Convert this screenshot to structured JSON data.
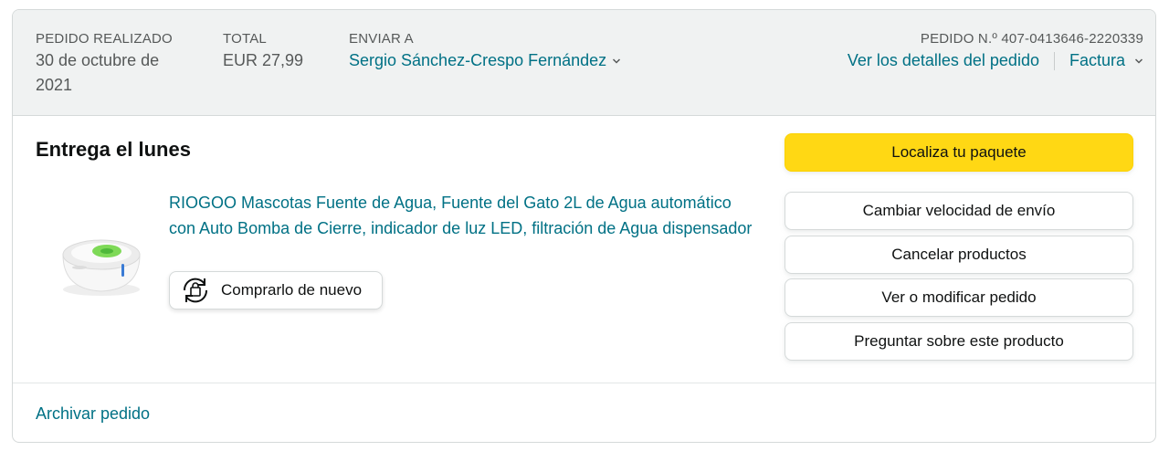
{
  "header": {
    "placed": {
      "label": "PEDIDO REALIZADO",
      "value_line1": "30 de octubre de",
      "value_line2": "2021"
    },
    "total": {
      "label": "TOTAL",
      "value": "EUR 27,99"
    },
    "ship_to": {
      "label": "ENVIAR A",
      "value": "Sergio Sánchez-Crespo Fernández"
    },
    "order_number": {
      "label": "PEDIDO N.º 407-0413646-2220339"
    },
    "details_link": "Ver los detalles del pedido",
    "invoice_link": "Factura"
  },
  "shipment": {
    "status_title": "Entrega el lunes",
    "product": {
      "title": "RIOGOO Mascotas Fuente de Agua, Fuente del Gato 2L de Agua automático con Auto Bomba de Cierre, indicador de luz LED, filtración de Agua dispensador",
      "image_icon": "pet-water-fountain-image"
    },
    "buy_again_label": "Comprarlo de nuevo"
  },
  "actions": {
    "track": "Localiza tu paquete",
    "change_speed": "Cambiar velocidad de envío",
    "cancel": "Cancelar productos",
    "modify": "Ver o modificar pedido",
    "ask": "Preguntar sobre este producto"
  },
  "footer": {
    "archive_link": "Archivar pedido"
  },
  "colors": {
    "link": "#007185",
    "primary_button": "#ffd814",
    "header_bg": "#f0f2f2"
  }
}
